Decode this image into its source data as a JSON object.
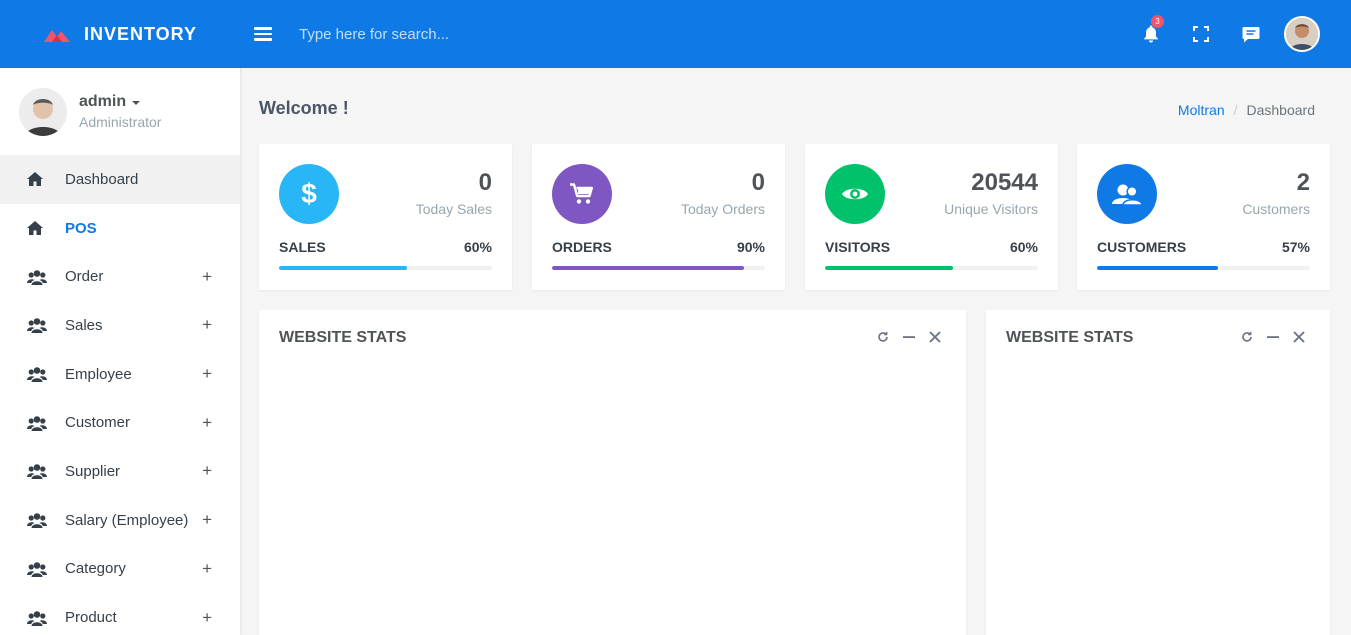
{
  "app": {
    "brand": "INVENTORY"
  },
  "header": {
    "search_placeholder": "Type here for search...",
    "notification_count": "3",
    "icons": [
      "menu-icon",
      "bell-icon",
      "fullscreen-icon",
      "chat-icon"
    ]
  },
  "user": {
    "name": "admin",
    "role": "Administrator"
  },
  "sidebar": {
    "items": [
      {
        "label": "Dashboard",
        "icon": "home-icon"
      },
      {
        "label": "POS",
        "icon": "home-icon"
      },
      {
        "label": "Order",
        "icon": "users-icon",
        "expand": "+"
      },
      {
        "label": "Sales",
        "icon": "users-icon",
        "expand": "+"
      },
      {
        "label": "Employee",
        "icon": "users-icon",
        "expand": "+"
      },
      {
        "label": "Customer",
        "icon": "users-icon",
        "expand": "+"
      },
      {
        "label": "Supplier",
        "icon": "users-icon",
        "expand": "+"
      },
      {
        "label": "Salary (Employee)",
        "icon": "users-icon",
        "expand": "+"
      },
      {
        "label": "Category",
        "icon": "users-icon",
        "expand": "+"
      },
      {
        "label": "Product",
        "icon": "users-icon",
        "expand": "+"
      }
    ]
  },
  "page": {
    "title": "Welcome !",
    "breadcrumb": [
      "Moltran",
      "Dashboard"
    ]
  },
  "cards": [
    {
      "value": "0",
      "subtitle": "Today Sales",
      "label": "SALES",
      "percent_text": "60%",
      "percent": 60,
      "color": "#29b6f6",
      "icon": "dollar-icon"
    },
    {
      "value": "0",
      "subtitle": "Today Orders",
      "label": "ORDERS",
      "percent_text": "90%",
      "percent": 90,
      "color": "#7e57c2",
      "icon": "cart-icon"
    },
    {
      "value": "20544",
      "subtitle": "Unique Visitors",
      "label": "VISITORS",
      "percent_text": "60%",
      "percent": 60,
      "color": "#00c26b",
      "icon": "eye-icon"
    },
    {
      "value": "2",
      "subtitle": "Customers",
      "label": "CUSTOMERS",
      "percent_text": "57%",
      "percent": 57,
      "color": "#0f7ae5",
      "icon": "customers-icon"
    }
  ],
  "panels": [
    {
      "title": "WEBSITE STATS"
    },
    {
      "title": "WEBSITE STATS"
    }
  ]
}
